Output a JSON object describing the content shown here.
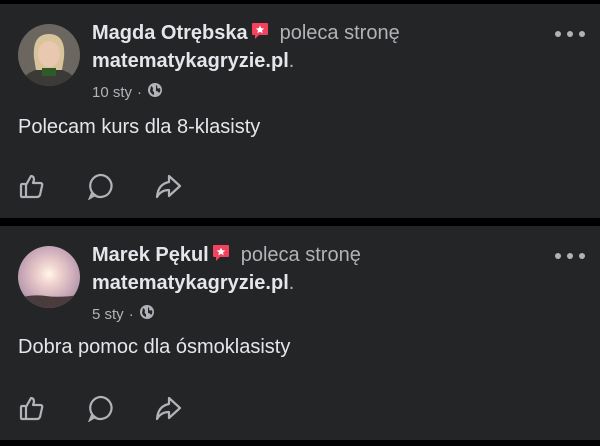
{
  "posts": [
    {
      "author": "Magda Otrębska",
      "verb": "poleca stronę",
      "page": "matematykagryzie.pl",
      "period": ".",
      "date": "10 sty",
      "separator": "·",
      "text": "Polecam kurs dla 8-klasisty"
    },
    {
      "author": "Marek Pękul",
      "verb": "poleca stronę",
      "page": "matematykagryzie.pl",
      "period": ".",
      "date": "5 sty",
      "separator": "·",
      "text": "Dobra pomoc dla ósmoklasisty"
    }
  ],
  "icons": {
    "recommend_badge": "recommend-star-icon",
    "privacy": "globe-icon",
    "more": "more-icon",
    "like": "like-icon",
    "comment": "comment-icon",
    "share": "share-icon"
  },
  "colors": {
    "background": "#000000",
    "card": "#242526",
    "primary_text": "#e4e6eb",
    "secondary_text": "#b0b3b8",
    "badge": "#f3425f"
  }
}
